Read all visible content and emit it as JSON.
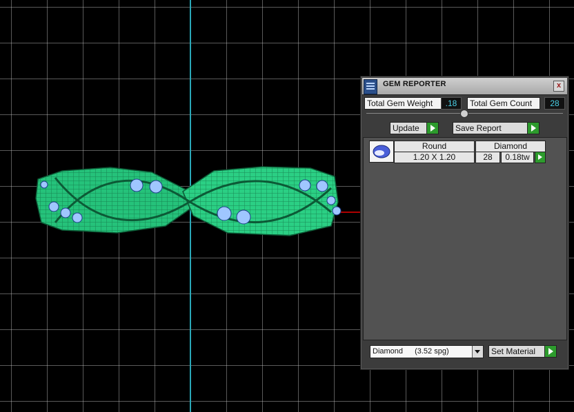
{
  "panel": {
    "title": "GEM REPORTER",
    "close_label": "x",
    "total_weight_label": "Total Gem Weight",
    "total_weight_value": ".18",
    "total_count_label": "Total Gem Count",
    "total_count_value": "28",
    "update_label": "Update",
    "save_report_label": "Save Report"
  },
  "gems": [
    {
      "shape": "Round",
      "material": "Diamond",
      "size": "1.20 X 1.20",
      "count": "28",
      "weight": "0.18tw"
    }
  ],
  "material_select": {
    "value": "Diamond",
    "spg": "(3.52 spg)"
  },
  "set_material_label": "Set Material",
  "colors": {
    "ring_wire": "#25c27a",
    "gem_fill": "#9fc6ff",
    "accent_green": "#2d9b2d",
    "value_text": "#4bd0e6"
  }
}
